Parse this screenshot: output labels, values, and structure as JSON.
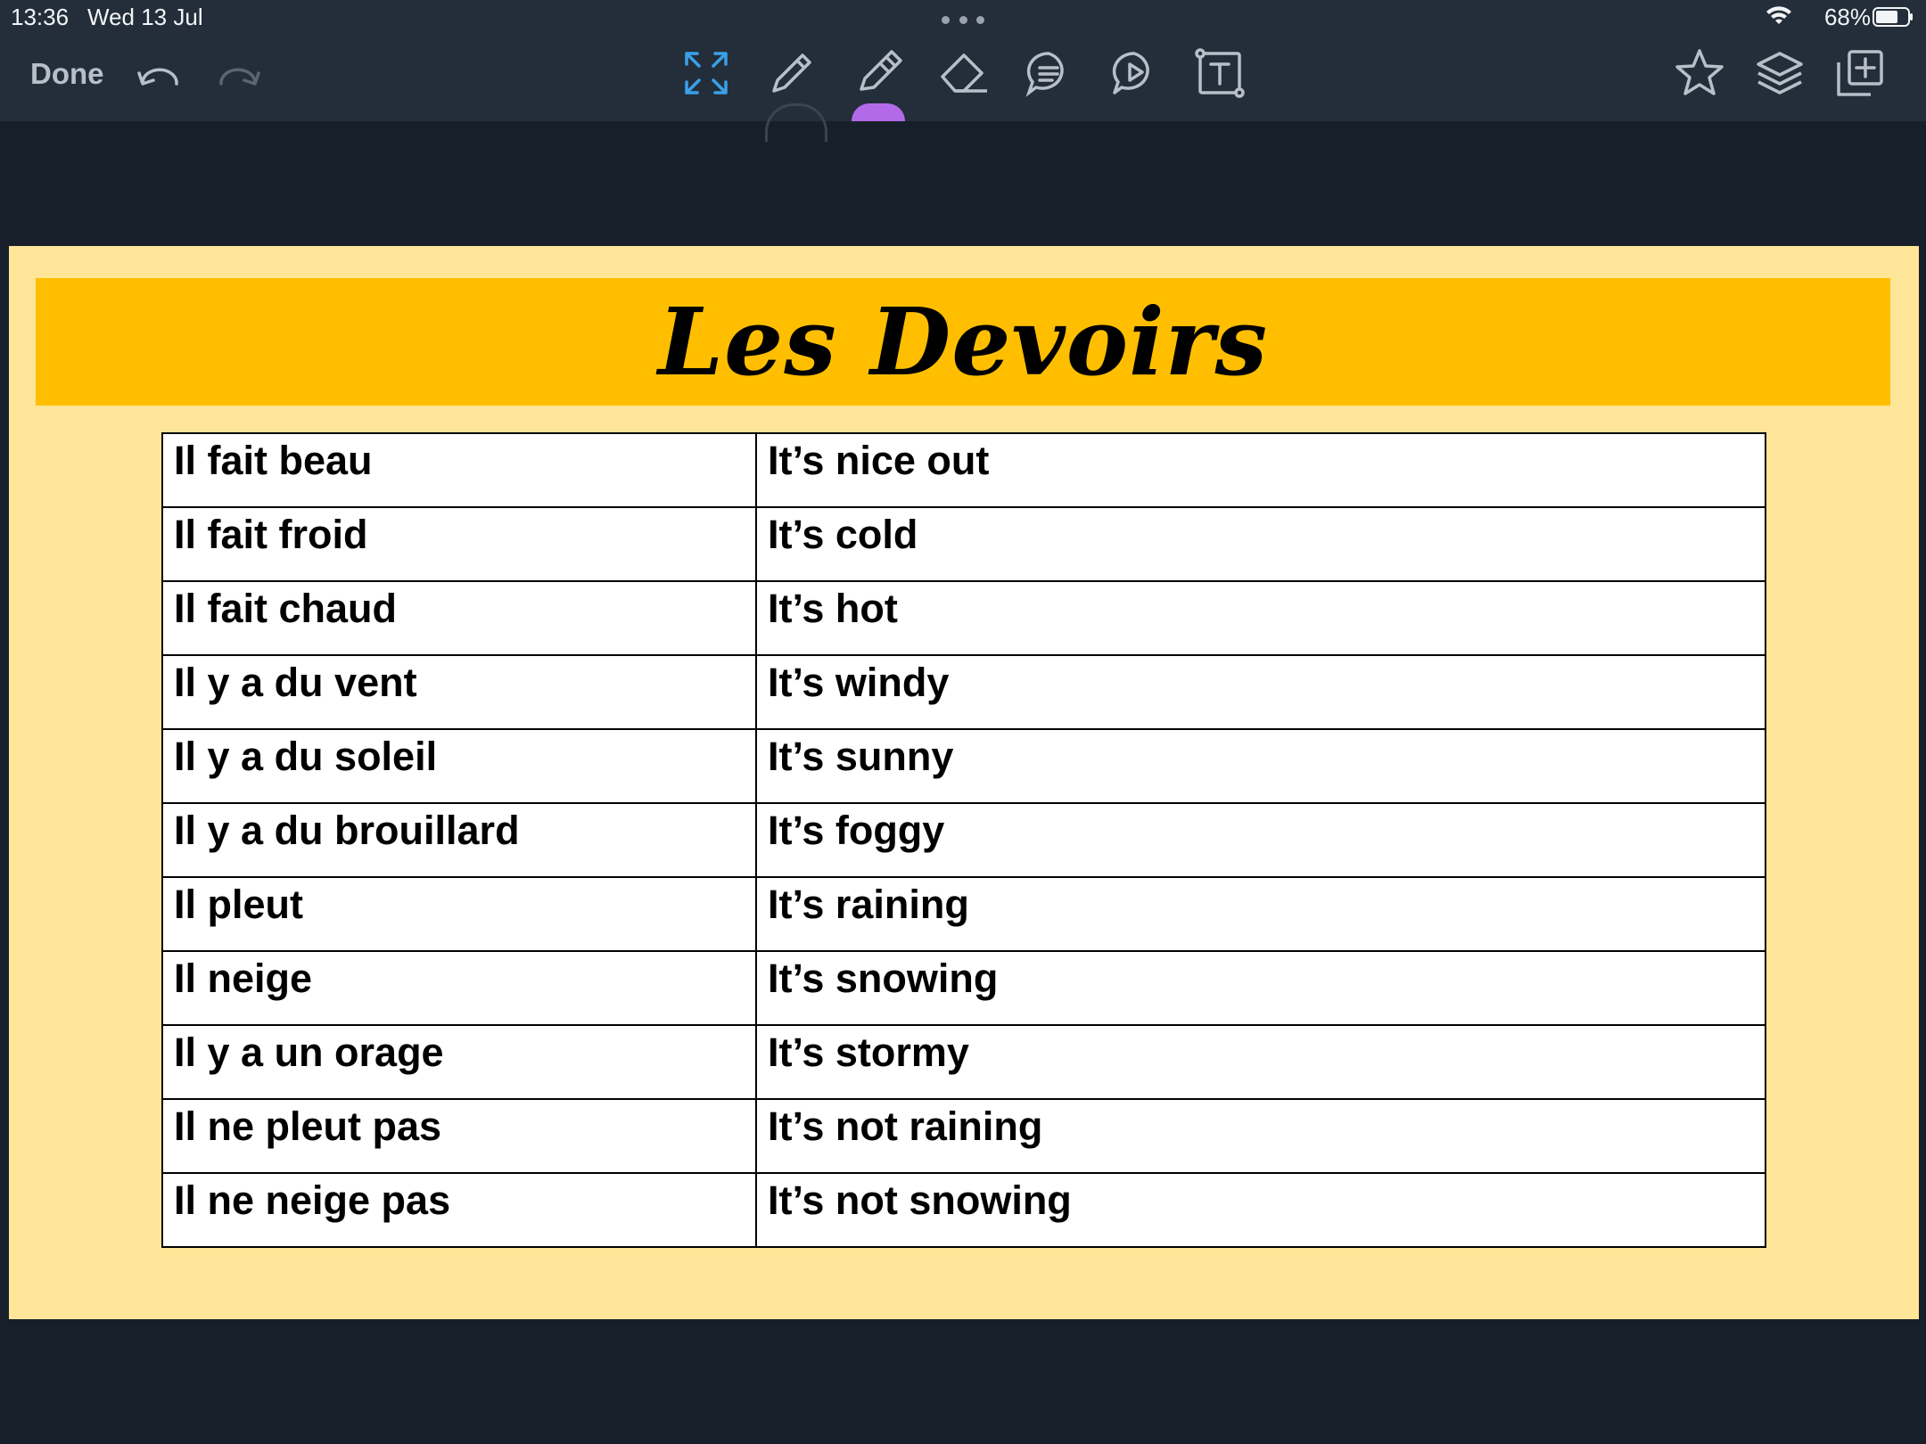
{
  "status_bar": {
    "time": "13:36",
    "date": "Wed 13 Jul",
    "battery": "68%"
  },
  "toolbar": {
    "done_label": "Done",
    "left_icons": [
      "undo-icon",
      "redo-icon"
    ],
    "center_icons": [
      "fullscreen-icon",
      "pencil-icon",
      "highlighter-icon",
      "eraser-icon",
      "comment-icon",
      "play-icon",
      "text-box-icon"
    ],
    "right_icons": [
      "star-icon",
      "layers-icon",
      "add-page-icon"
    ],
    "accent_color": "#3aa0e8",
    "pen_color": "#b36ae8"
  },
  "slide": {
    "title": "Les Devoirs",
    "background_color": "#fee597",
    "band_color": "#ffbf00",
    "rows": [
      {
        "fr": "Il fait beau",
        "en": "It’s nice out"
      },
      {
        "fr": "Il fait froid",
        "en": "It’s cold"
      },
      {
        "fr": "Il fait chaud",
        "en": "It’s hot"
      },
      {
        "fr": "Il y a du vent",
        "en": "It’s windy"
      },
      {
        "fr": "Il y a du soleil",
        "en": "It’s sunny"
      },
      {
        "fr": "Il y a du brouillard",
        "en": "It’s foggy"
      },
      {
        "fr": "Il pleut",
        "en": "It’s raining"
      },
      {
        "fr": "Il neige",
        "en": "It’s snowing"
      },
      {
        "fr": "Il y a un orage",
        "en": "It’s stormy"
      },
      {
        "fr": "Il ne pleut pas",
        "en": "It’s not raining"
      },
      {
        "fr": "Il ne neige pas",
        "en": "It’s not snowing"
      }
    ]
  }
}
